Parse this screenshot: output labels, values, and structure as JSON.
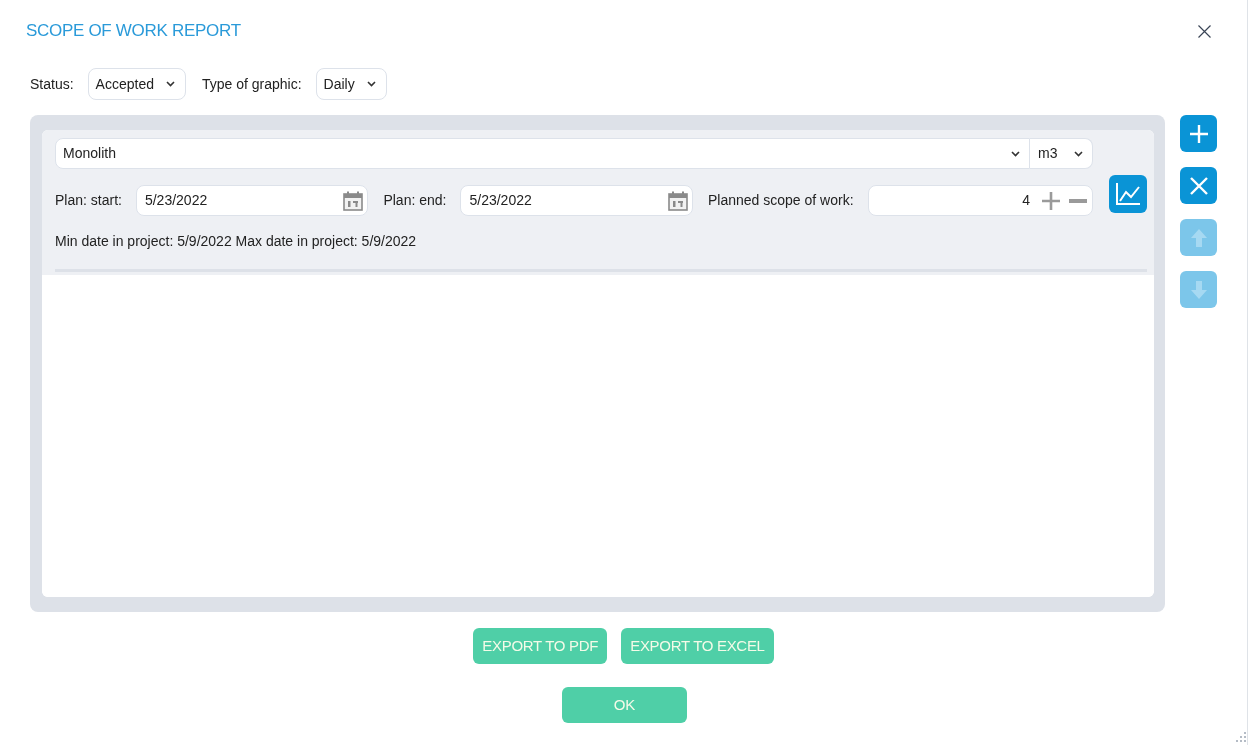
{
  "dialog": {
    "title": "SCOPE OF WORK REPORT"
  },
  "filters": [
    {
      "label": "Status:",
      "value": "Accepted"
    },
    {
      "label": "Type of graphic:",
      "value": "Daily"
    }
  ],
  "work_item": {
    "name": "Monolith",
    "unit": "m3",
    "plan_start": {
      "label": "Plan: start:",
      "value": "5/23/2022"
    },
    "plan_end": {
      "label": "Plan: end:",
      "value": "5/23/2022"
    },
    "planned_scope": {
      "label": "Planned scope of work:",
      "value": "4"
    },
    "date_range": "Min date in project: 5/9/2022 Max date in project: 5/9/2022"
  },
  "side_actions": [
    {
      "kind": "add",
      "disabled": false
    },
    {
      "kind": "remove",
      "disabled": false
    },
    {
      "kind": "move_up",
      "disabled": true
    },
    {
      "kind": "move_down",
      "disabled": true
    }
  ],
  "export_buttons": [
    "EXPORT TO PDF",
    "EXPORT TO EXCEL"
  ],
  "buttons": [
    "OK"
  ]
}
